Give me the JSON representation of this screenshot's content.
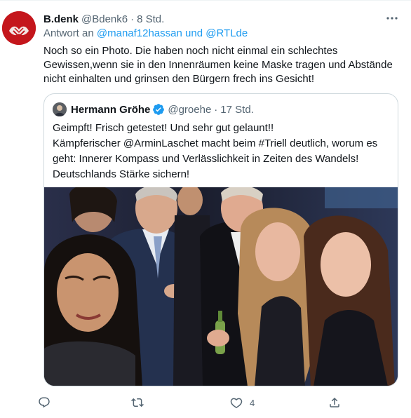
{
  "tweet": {
    "author_name": "B.denk",
    "author_handle": "@Bdenk6",
    "separator": "·",
    "time": "8 Std.",
    "reply_prefix": "Antwort an",
    "reply_to_1": "@manaf12hassan",
    "reply_conjunction": "und",
    "reply_to_2": "@RTLde",
    "text_line_1": "Noch so ein Photo. Die haben noch nicht einmal ein schlechtes",
    "text_line_2": "Gewissen,wenn sie in den Innenräumen keine Maske tragen und Abstände",
    "text_line_3": "nicht einhalten und grinsen den Bürgern frech ins Gesicht!"
  },
  "quoted_tweet": {
    "author_name": "Hermann Gröhe",
    "author_handle": "@groehe",
    "separator": "·",
    "time": "17 Std.",
    "verified": true,
    "text_line_1": "Geimpft! Frisch getestet! Und sehr gut gelaunt!!",
    "text_line_2": "Kämpferischer @ArminLaschet macht beim #Triell deutlich, worum es",
    "text_line_3": "geht: Innerer Kompass und Verlässlichkeit in Zeiten des Wandels!",
    "text_line_4": "Deutschlands Stärke sichern!"
  },
  "actions": {
    "reply_count": "",
    "retweet_count": "",
    "like_count": "4",
    "share_count": ""
  },
  "icons": {
    "more": "more-horizontal-icon",
    "reply": "reply-icon",
    "retweet": "retweet-icon",
    "like": "heart-icon",
    "share": "share-icon",
    "verified": "verified-badge-icon"
  },
  "colors": {
    "link": "#1d9bf0",
    "muted": "#536471",
    "text": "#0f1419",
    "border": "#cfd9de",
    "avatar_red": "#c4161c"
  }
}
